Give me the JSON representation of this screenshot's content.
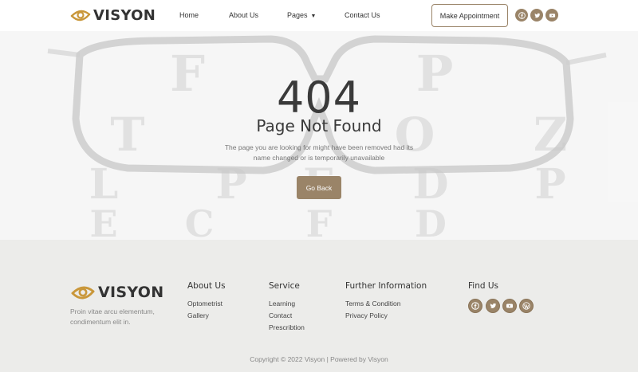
{
  "brand": {
    "name": "VISYON"
  },
  "nav": {
    "home": "Home",
    "about": "About Us",
    "pages": "Pages",
    "contact": "Contact Us",
    "appointment": "Make Appointment"
  },
  "hero": {
    "code": "404",
    "title": "Page Not Found",
    "description": "The page you are looking for might have been removed had its name changed or is temporarily unavailable",
    "button": "Go Back",
    "chart_letters": [
      "F",
      "P",
      "T",
      "O",
      "Z",
      "L",
      "P",
      "E",
      "D",
      "P",
      "E",
      "C",
      "F",
      "D"
    ]
  },
  "footer": {
    "description": "Proin vitae arcu elementum, condimentum elit in.",
    "about": {
      "title": "About Us",
      "links": [
        "Optometrist",
        "Gallery"
      ]
    },
    "service": {
      "title": "Service",
      "links": [
        "Learning",
        "Contact",
        "Prescribtion"
      ]
    },
    "info": {
      "title": "Further Information",
      "links": [
        "Terms & Condition",
        "Privacy Policy"
      ]
    },
    "find": {
      "title": "Find Us"
    },
    "copyright": "Copyright © 2022 Visyon | Powered by Visyon"
  },
  "social_icons": [
    "facebook-icon",
    "twitter-icon",
    "youtube-icon",
    "wordpress-icon"
  ],
  "colors": {
    "accent": "#9a8468",
    "text": "#333333",
    "footer_bg": "#ececea"
  }
}
